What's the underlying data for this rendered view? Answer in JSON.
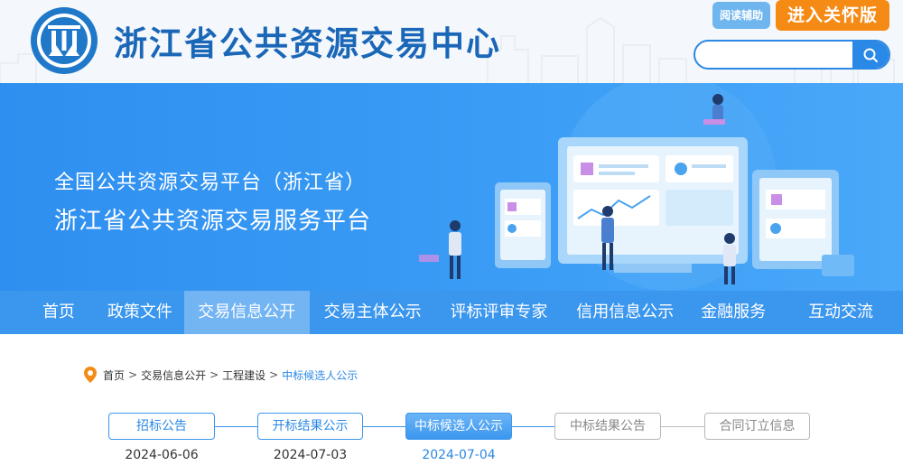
{
  "header": {
    "site_title": "浙江省公共资源交易中心",
    "reader_button": "阅读辅助",
    "care_button": "进入关怀版",
    "search": {
      "placeholder": "",
      "icon": "search-icon"
    }
  },
  "banner": {
    "line1": "全国公共资源交易平台（浙江省）",
    "line2": "浙江省公共资源交易服务平台"
  },
  "nav": {
    "items": [
      {
        "label": "首页"
      },
      {
        "label": "政策文件"
      },
      {
        "label": "交易信息公开",
        "active": true
      },
      {
        "label": "交易主体公示"
      },
      {
        "label": "评标评审专家"
      },
      {
        "label": "信用信息公示"
      },
      {
        "label": "金融服务"
      },
      {
        "label": "互动交流"
      }
    ]
  },
  "breadcrumb": {
    "icon": "location-pin-icon",
    "items": [
      "首页",
      "交易信息公开",
      "工程建设",
      "中标候选人公示"
    ],
    "separator": ">"
  },
  "steps": {
    "items": [
      {
        "label": "招标公告",
        "date": "2024-06-06",
        "state": "done"
      },
      {
        "label": "开标结果公示",
        "date": "2024-07-03",
        "state": "done"
      },
      {
        "label": "中标候选人公示",
        "date": "2024-07-04",
        "state": "active"
      },
      {
        "label": "中标结果公告",
        "date": "",
        "state": "pending"
      },
      {
        "label": "合同订立信息",
        "date": "",
        "state": "pending"
      }
    ]
  },
  "colors": {
    "brand_blue": "#2a88e6",
    "nav_blue": "#3b96ee",
    "care_orange": "#f58a14",
    "title_blue": "#1a67b8"
  }
}
